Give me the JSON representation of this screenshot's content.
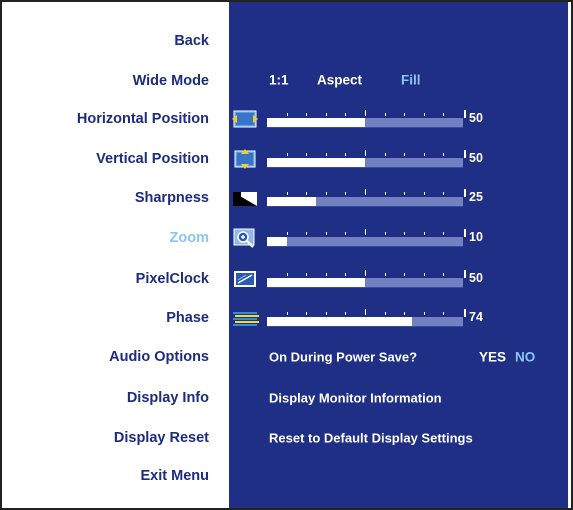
{
  "menu": {
    "items": [
      {
        "label": "Back"
      },
      {
        "label": "Wide Mode"
      },
      {
        "label": "Horizontal Position"
      },
      {
        "label": "Vertical Position"
      },
      {
        "label": "Sharpness"
      },
      {
        "label": "Zoom",
        "selected": true
      },
      {
        "label": "PixelClock"
      },
      {
        "label": "Phase"
      },
      {
        "label": "Audio Options"
      },
      {
        "label": "Display Info"
      },
      {
        "label": "Display Reset"
      },
      {
        "label": "Exit Menu"
      }
    ]
  },
  "wide_mode": {
    "options": [
      "1:1",
      "Aspect",
      "Fill"
    ],
    "selected": "Fill"
  },
  "sliders": [
    {
      "name": "horizontal-position",
      "icon": "horizontal-position-icon",
      "value": "50",
      "percent": 50
    },
    {
      "name": "vertical-position",
      "icon": "vertical-position-icon",
      "value": "50",
      "percent": 50
    },
    {
      "name": "sharpness",
      "icon": "sharpness-icon",
      "value": "25",
      "percent": 25
    },
    {
      "name": "zoom",
      "icon": "zoom-icon",
      "value": "10",
      "percent": 10
    },
    {
      "name": "pixel-clock",
      "icon": "pixel-clock-icon",
      "value": "50",
      "percent": 50
    },
    {
      "name": "phase",
      "icon": "phase-icon",
      "value": "74",
      "percent": 74
    }
  ],
  "audio": {
    "label": "On During Power Save?",
    "yes": "YES",
    "no": "NO",
    "selected": "NO"
  },
  "display_info": {
    "label": "Display Monitor Information"
  },
  "display_reset": {
    "label": "Reset to Default Display Settings"
  },
  "colors": {
    "panel_bg": "#1f2f86",
    "menu_text": "#1c2c80",
    "highlight": "#8cc4f2",
    "track": "#7080c0",
    "fill": "#ffffff"
  }
}
